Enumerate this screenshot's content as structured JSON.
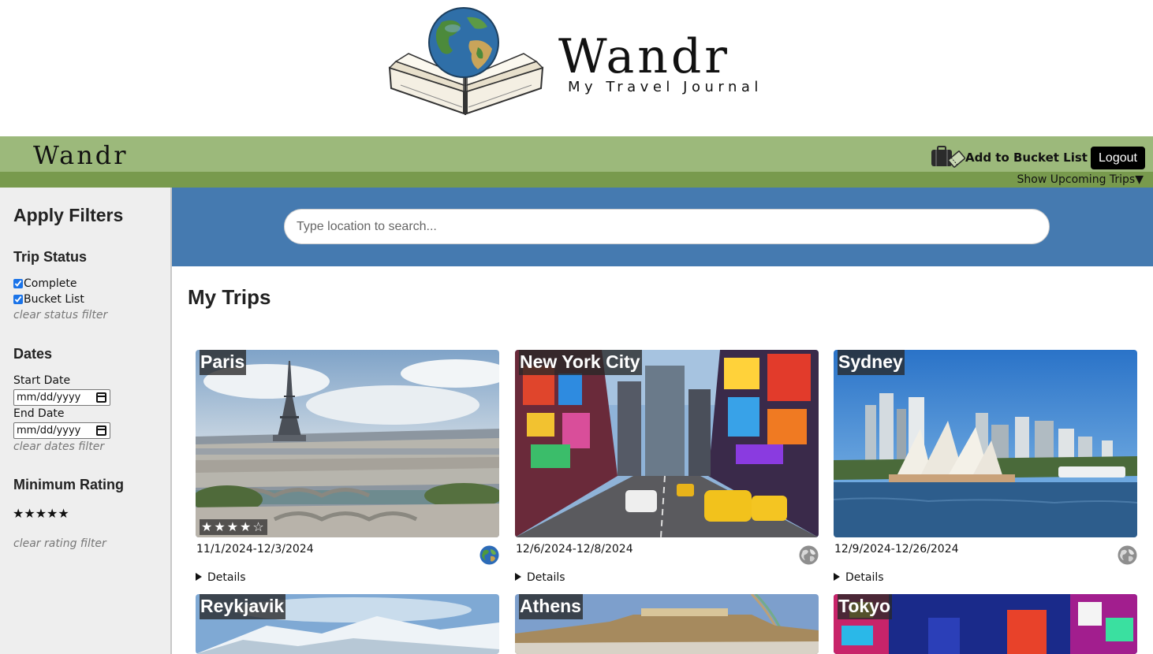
{
  "header": {
    "logo_title": "Wandr",
    "logo_subtitle": "My Travel Journal"
  },
  "navbar": {
    "brand": "Wandr",
    "bucket_label": "Add to Bucket List",
    "logout_label": "Logout",
    "upcoming_label": "Show Upcoming Trips▼",
    "bar_color": "#9cb97b",
    "subbar_color": "#789a4d"
  },
  "sidebar": {
    "title": "Apply Filters",
    "status_heading": "Trip Status",
    "status_options": [
      {
        "label": "Complete",
        "checked": true
      },
      {
        "label": "Bucket List",
        "checked": true
      }
    ],
    "clear_status": "clear status filter",
    "dates_heading": "Dates",
    "start_label": "Start Date",
    "start_value": "mm/dd/yyyy",
    "end_label": "End Date",
    "end_value": "mm/dd/yyyy",
    "clear_dates": "clear dates filter",
    "rating_heading": "Minimum Rating",
    "rating_stars": "★★★★★",
    "clear_rating": "clear rating filter"
  },
  "search": {
    "placeholder": "Type location to search...",
    "band_color": "#457ab0"
  },
  "main": {
    "title": "My Trips",
    "details_label": "Details",
    "trips": [
      {
        "name": "Paris",
        "dates": "11/1/2024-12/3/2024",
        "rating": 4,
        "rating_text": "★★★★☆",
        "globe": "colored-globe-icon"
      },
      {
        "name": "New York City",
        "dates": "12/6/2024-12/8/2024",
        "rating": null,
        "globe": "gray-globe-icon"
      },
      {
        "name": "Sydney",
        "dates": "12/9/2024-12/26/2024",
        "rating": null,
        "globe": "gray-globe-icon"
      },
      {
        "name": "Reykjavik"
      },
      {
        "name": "Athens"
      },
      {
        "name": "Tokyo"
      }
    ]
  }
}
